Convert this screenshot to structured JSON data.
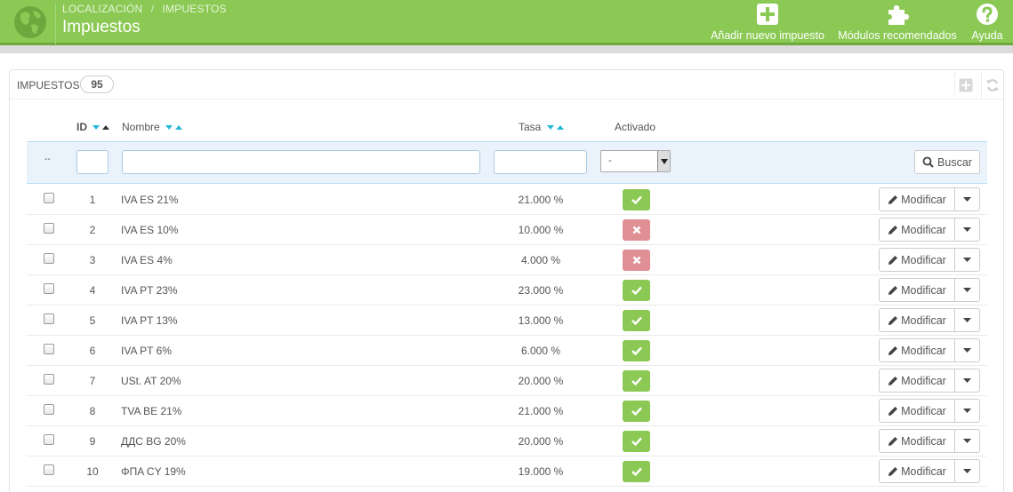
{
  "header": {
    "breadcrumb": [
      "LOCALIZACIÓN",
      "IMPUESTOS"
    ],
    "breadcrumb_separator": "/",
    "title": "Impuestos",
    "actions": [
      {
        "label": "Añadir nuevo impuesto",
        "icon": "plus-square-icon"
      },
      {
        "label": "Módulos recomendados",
        "icon": "puzzle-icon"
      },
      {
        "label": "Ayuda",
        "icon": "help-circle-icon"
      }
    ],
    "accent_color": "#8bc954"
  },
  "panel": {
    "title": "IMPUESTOS",
    "count": "95"
  },
  "table": {
    "columns": {
      "id": "ID",
      "name": "Nombre",
      "rate": "Tasa",
      "active": "Activado"
    },
    "filter": {
      "dashes": "--",
      "active_select_value": "-",
      "search_label": "Buscar"
    },
    "edit_label": "Modificar",
    "rows": [
      {
        "id": "1",
        "name": "IVA ES 21%",
        "rate": "21.000 %",
        "active": true
      },
      {
        "id": "2",
        "name": "IVA ES 10%",
        "rate": "10.000 %",
        "active": false
      },
      {
        "id": "3",
        "name": "IVA ES 4%",
        "rate": "4.000 %",
        "active": false
      },
      {
        "id": "4",
        "name": "IVA PT 23%",
        "rate": "23.000 %",
        "active": true
      },
      {
        "id": "5",
        "name": "IVA PT 13%",
        "rate": "13.000 %",
        "active": true
      },
      {
        "id": "6",
        "name": "IVA PT 6%",
        "rate": "6.000 %",
        "active": true
      },
      {
        "id": "7",
        "name": "USt. AT 20%",
        "rate": "20.000 %",
        "active": true
      },
      {
        "id": "8",
        "name": "TVA BE 21%",
        "rate": "21.000 %",
        "active": true
      },
      {
        "id": "9",
        "name": "ДДС BG 20%",
        "rate": "20.000 %",
        "active": true
      },
      {
        "id": "10",
        "name": "ΦΠΑ CY 19%",
        "rate": "19.000 %",
        "active": true
      }
    ]
  }
}
